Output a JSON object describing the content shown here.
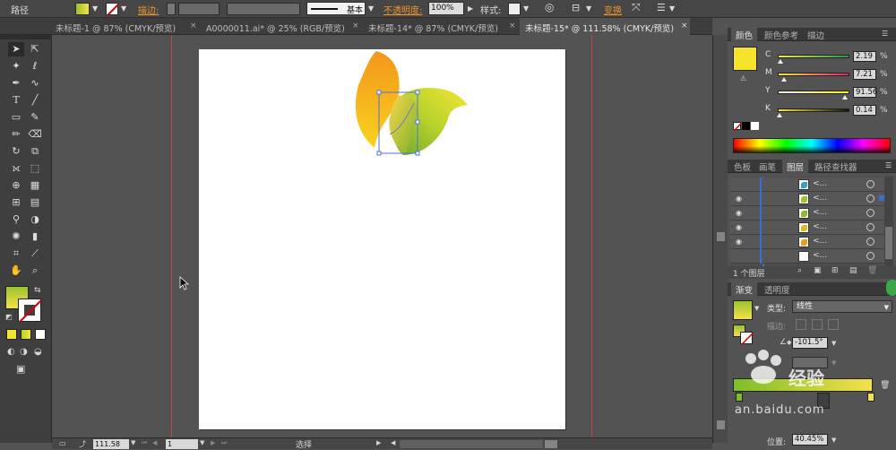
{
  "control_bar": {
    "object_type": "路径",
    "stroke_label": "描边:",
    "stroke_profile": "基本",
    "opacity_label": "不透明度:",
    "opacity_value": "100%",
    "style_label": "样式:",
    "transform_label": "变换"
  },
  "tabs": [
    {
      "label": "未标题-1 @ 87% (CMYK/预览)",
      "close": "×"
    },
    {
      "label": "A0000011.ai* @ 25% (RGB/预览)",
      "close": "×"
    },
    {
      "label": "未标题-14* @ 87% (CMYK/预览)",
      "close": "×"
    },
    {
      "label": "未标题-15* @ 111.58% (CMYK/预览)",
      "close": "×"
    }
  ],
  "status": {
    "zoom": "111.58",
    "page": "1",
    "tool_name": "选择"
  },
  "color_panel": {
    "tabs": [
      "颜色",
      "颜色参考",
      "描边"
    ],
    "channels": [
      {
        "label": "C",
        "value": "2.19",
        "pct": "%",
        "level": 0.02,
        "gradient": "linear-gradient(90deg,#f4e94b,#1f9a49)"
      },
      {
        "label": "M",
        "value": "7.21",
        "pct": "%",
        "level": 0.07,
        "gradient": "linear-gradient(90deg,#f6e83d,#e0206a)"
      },
      {
        "label": "Y",
        "value": "91.56",
        "pct": "%",
        "level": 0.92,
        "gradient": "linear-gradient(90deg,#ffffff,#fff200)"
      },
      {
        "label": "K",
        "value": "0.14",
        "pct": "%",
        "level": 0.01,
        "gradient": "linear-gradient(90deg,#f6e83d,#111111)"
      }
    ],
    "swatch_color": "#f6e42b"
  },
  "layers_panel": {
    "tabs": [
      "色板",
      "画笔",
      "图层",
      "路径查找器"
    ],
    "rows": [
      {
        "name": "<...",
        "visible": false,
        "thumb_color": "#3aa0c8"
      },
      {
        "name": "<...",
        "visible": true,
        "thumb_color": "#a2c42a"
      },
      {
        "name": "<...",
        "visible": true,
        "thumb_color": "#8cbc29"
      },
      {
        "name": "<...",
        "visible": true,
        "thumb_color": "#e4b52a"
      },
      {
        "name": "<...",
        "visible": true,
        "thumb_color": "#ef9c1c"
      },
      {
        "name": "<...",
        "visible": false,
        "thumb_color": "#ffffff"
      }
    ],
    "footer": "1 个图层"
  },
  "gradient_panel": {
    "tabs": [
      "渐变",
      "透明度"
    ],
    "type_label": "类型:",
    "type_value": "线性",
    "stroke_label": "描边:",
    "angle_value": "-101.5°",
    "location_label": "位置:",
    "location_value": "40.45%",
    "accent": "#7dbe2a"
  },
  "watermark": {
    "text_brand": "经验",
    "text_url": "an.baidu.com"
  }
}
